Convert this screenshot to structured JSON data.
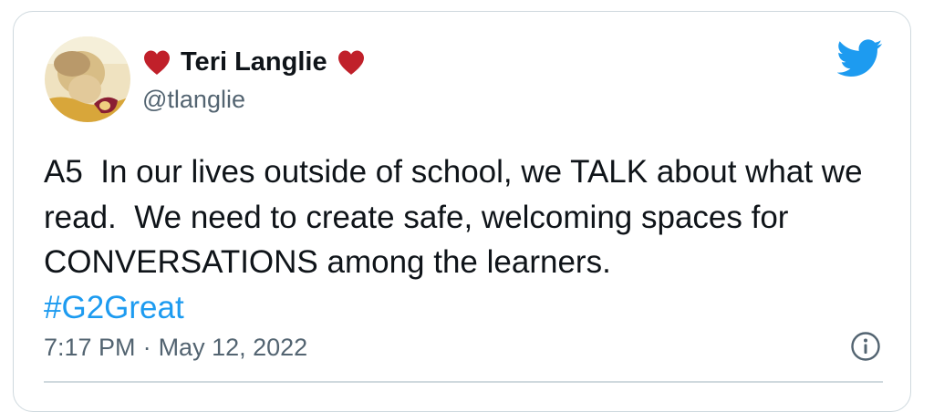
{
  "tweet": {
    "author_name": "Teri Langlie",
    "handle": "@tlanglie",
    "text": "A5  In our lives outside of school, we TALK about what we read.  We need to create safe, welcoming spaces for CONVERSATIONS among the learners.",
    "hashtag": "#G2Great",
    "time": "7:17 PM",
    "separator": "·",
    "date": "May 12, 2022"
  },
  "icons": {
    "name_prefix": "heart-icon",
    "name_suffix": "heart-icon",
    "brand": "twitter-bird-icon",
    "info": "info-icon"
  },
  "colors": {
    "heart": "#c0202a",
    "twitter_blue": "#1d9bf0",
    "text": "#0f1419",
    "secondary": "#536471",
    "border": "#cfd9de"
  }
}
